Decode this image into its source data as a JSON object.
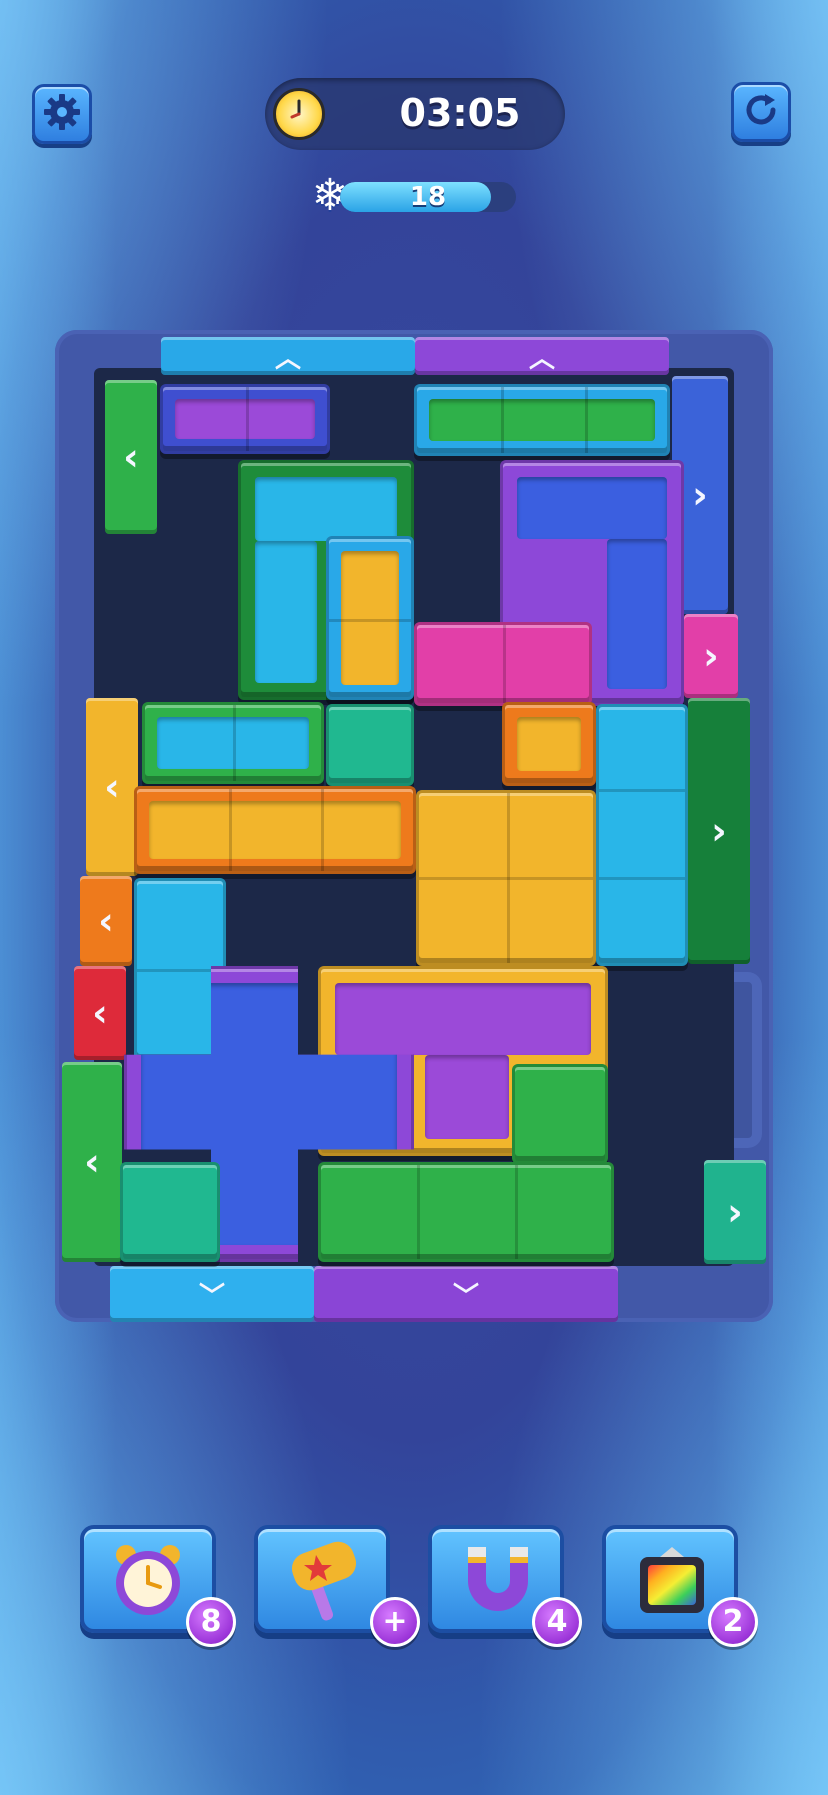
{
  "hud": {
    "settings_icon": "gear-icon",
    "restart_icon": "restart-icon",
    "timer_icon": "clock-icon",
    "timer": "03:05",
    "freeze_icon": "snowflake-icon",
    "freeze_count": "18",
    "freeze_fill_fraction": 0.86
  },
  "gates": {
    "top_left": {
      "color": "#29a8e8",
      "arrow": "up"
    },
    "top_right": {
      "color": "#8d48d8",
      "arrow": "up"
    },
    "left_1": {
      "color": "#2fb14a",
      "arrow": "left"
    },
    "left_2": {
      "color": "#f2b52c",
      "arrow": "left"
    },
    "left_3": {
      "color": "#ee7a1c",
      "arrow": "left"
    },
    "left_4": {
      "color": "#de2a3a",
      "arrow": "left"
    },
    "left_5": {
      "color": "#2fb14a",
      "arrow": "left"
    },
    "right_1": {
      "color": "#3b63d9",
      "arrow": "right"
    },
    "right_2": {
      "color": "#e23fa8",
      "arrow": "right"
    },
    "right_3": {
      "color": "#16803a",
      "arrow": "right"
    },
    "right_4": {
      "color": "#20b38e",
      "arrow": "right"
    },
    "bottom_left": {
      "color": "#2fb0ee",
      "arrow": "down"
    },
    "bottom_right": {
      "color": "#8a45d6",
      "arrow": "down"
    }
  },
  "boosters": [
    {
      "name": "alarm-clock",
      "icon": "alarm-clock-icon",
      "count": "8"
    },
    {
      "name": "hammer",
      "icon": "hammer-icon",
      "count": "+"
    },
    {
      "name": "magnet",
      "icon": "magnet-icon",
      "count": "4"
    },
    {
      "name": "rainbow-box",
      "icon": "rainbow-box-icon",
      "count": "2"
    }
  ]
}
